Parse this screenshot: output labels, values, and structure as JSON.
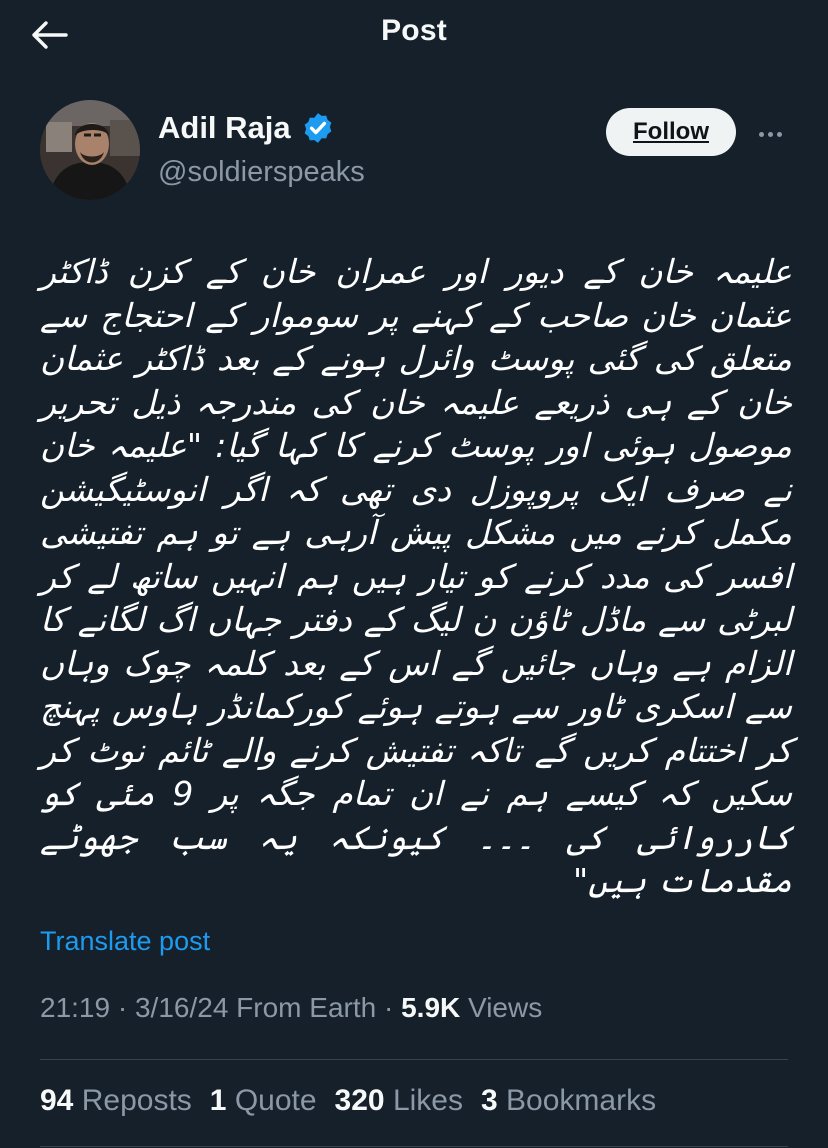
{
  "header": {
    "title": "Post"
  },
  "author": {
    "display_name": "Adil Raja",
    "handle": "@soldierspeaks",
    "verified_color": "#1d9bf0"
  },
  "actions": {
    "follow_label": "Follow"
  },
  "post": {
    "text": "علیمہ خان کے دیور اور عمران خان کے کزن ڈاکٹر عثمان خان صاحب کے کہنے پر سوموار کے احتجاج سے متعلق کی گئی پوسٹ وائرل ہونے کے بعد ڈاکٹر عثمان خان کے ہی ذریعے علیمہ خان کی مندرجہ ذیل تحریر موصول ہوئی اور پوسٹ کرنے کا کہا گیا: \"علیمہ خان نے صرف ایک پروپوزل دی تھی کہ اگر انوسٹیگیشن مکمل کرنے میں مشکل پیش آرہی ہے تو ہم تفتیشی افسر کی مدد کرنے کو تیار ہیں ہم انہیں ساتھ لے کر لبرٹی سے ماڈل ٹاؤن ن لیگ کے دفتر جہاں اگ لگانے کا الزام ہے وہاں جائیں گے اس کے بعد کلمہ چوک وہاں سے اسکری ٹاور سے ہوتے ہوئے کورکمانڈر ہاوس پہنچ کر اختتام کریں گے تاکہ تفتیش کرنے والے ٹائم نوٹ کر سکیں کہ کیسے ہم نے ان تمام جگہ پر 9 مئی کو کارروائی کی ۔۔۔ کیونکہ یہ سب جھوٹے مقدمات ہیں\"",
    "translate_label": "Translate post",
    "time": "21:19",
    "date": "3/16/24",
    "source": "From Earth",
    "views_count": "5.9K",
    "views_label": "Views"
  },
  "stats": {
    "reposts_count": "94",
    "reposts_label": "Reposts",
    "quotes_count": "1",
    "quotes_label": "Quote",
    "likes_count": "320",
    "likes_label": "Likes",
    "bookmarks_count": "3",
    "bookmarks_label": "Bookmarks"
  }
}
